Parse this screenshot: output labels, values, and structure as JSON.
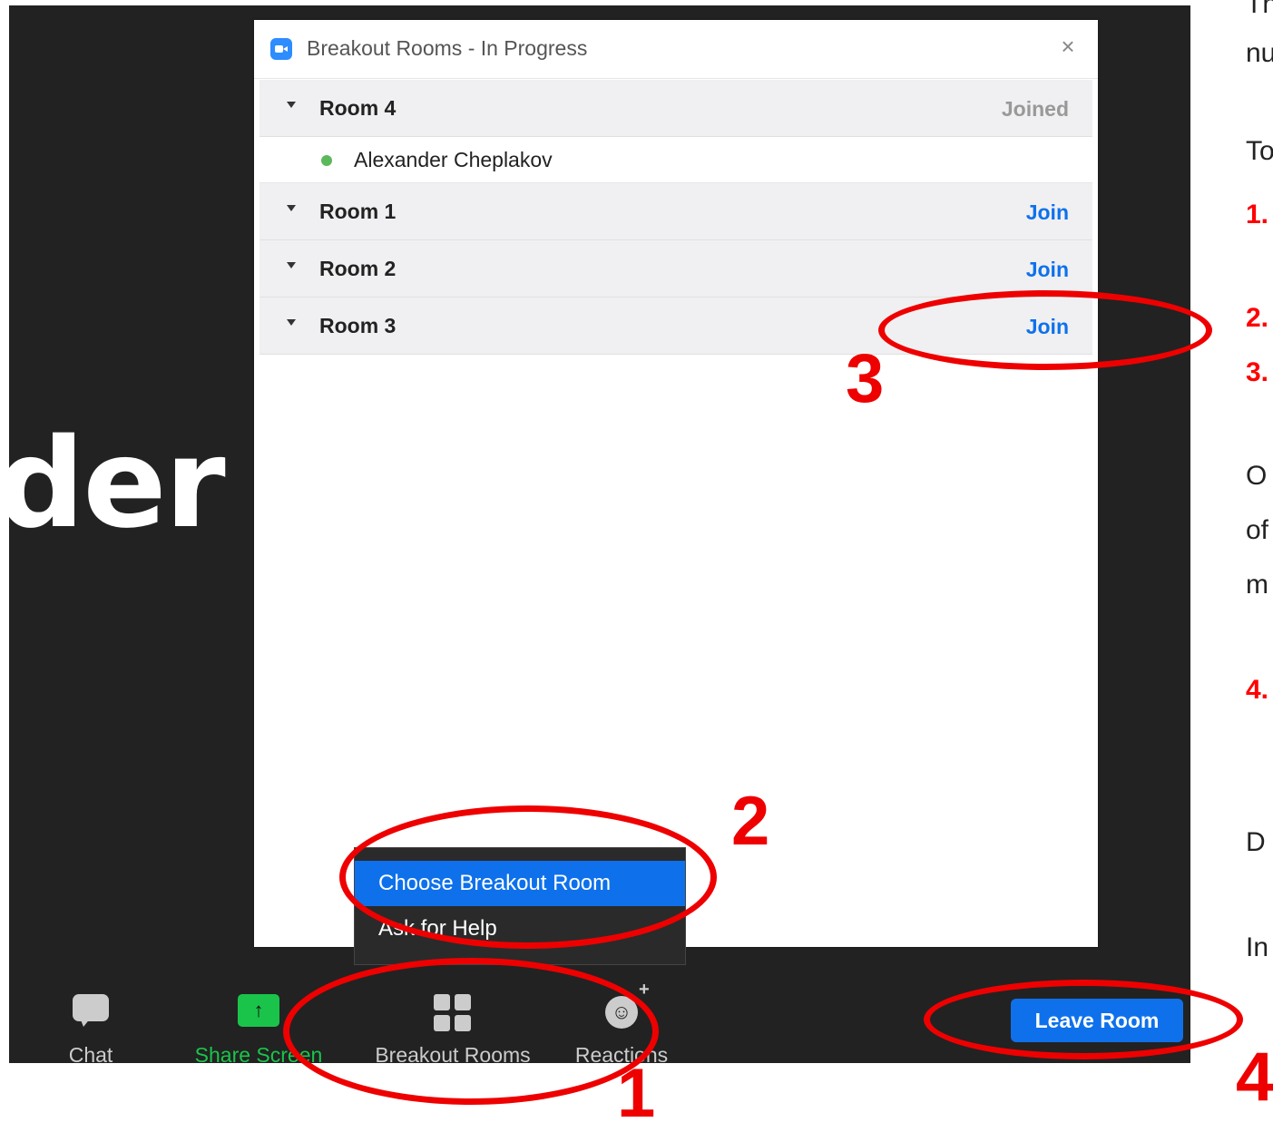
{
  "background": {
    "participant_name_fragment": "der"
  },
  "dialog": {
    "title": "Breakout Rooms - In Progress",
    "close_glyph": "×",
    "rooms": [
      {
        "name": "Room 4",
        "action": "Joined",
        "participants": [
          "Alexander Cheplakov"
        ]
      },
      {
        "name": "Room 1",
        "action": "Join"
      },
      {
        "name": "Room 2",
        "action": "Join"
      },
      {
        "name": "Room 3",
        "action": "Join"
      }
    ]
  },
  "context_menu": {
    "items": [
      "Choose Breakout Room",
      "Ask for Help"
    ]
  },
  "toolbar": {
    "chat_label": "Chat",
    "share_label": "Share Screen",
    "share_glyph": "↑",
    "breakout_label": "Breakout Rooms",
    "reactions_label": "Reactions",
    "reactions_glyph": "☺",
    "reactions_plus": "+",
    "leave_label": "Leave Room"
  },
  "slide_text": {
    "line1": "Th",
    "line2": "nu",
    "line3": "To",
    "step1": "1.",
    "step2": "2.",
    "step3": "3.",
    "line4": "O",
    "line5": "of",
    "line6": "m",
    "step4": "4.",
    "line7": "D",
    "line8": "In"
  },
  "annotations": {
    "n1": "1",
    "n2": "2",
    "n3": "3",
    "n4": "4"
  },
  "colors": {
    "accent_blue": "#0e71eb",
    "annotation_red": "#ee0000",
    "share_green": "#1ac44a",
    "status_green": "#5cb85c"
  }
}
